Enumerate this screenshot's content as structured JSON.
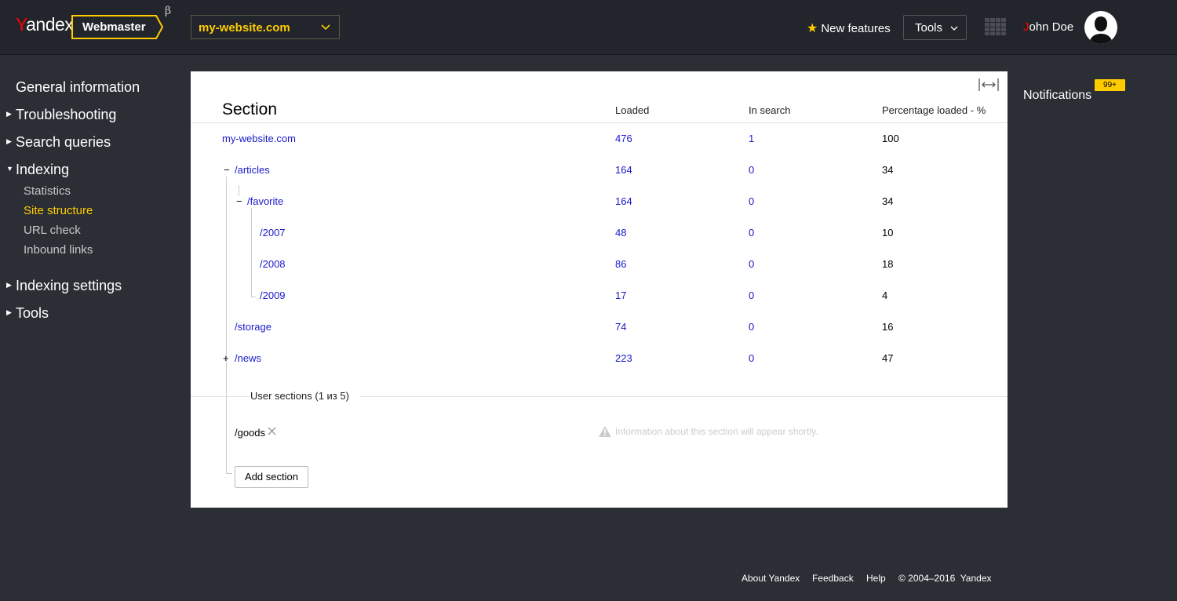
{
  "header": {
    "logo_y": "Y",
    "logo_rest": "andex",
    "product_label": "Webmaster",
    "beta_symbol": "β",
    "site_select_value": "my-website.com",
    "new_features_label": "New features",
    "tools_label": "Tools",
    "user_initial": "J",
    "user_rest": "ohn Doe",
    "accent_color": "#ffcc00"
  },
  "sidebar": {
    "general": "General information",
    "troubleshooting": "Troubleshooting",
    "search_queries": "Search queries",
    "indexing": "Indexing",
    "statistics": "Statistics",
    "site_structure": "Site structure",
    "url_check": "URL check",
    "inbound_links": "Inbound links",
    "indexing_settings": "Indexing settings",
    "tools": "Tools"
  },
  "table": {
    "headers": {
      "section": "Section",
      "loaded": "Loaded",
      "in_search": "In search",
      "percentage": "Percentage loaded - %"
    },
    "rows": [
      {
        "name": "my-website.com",
        "loaded": "476",
        "in_search": "1",
        "percent": "100"
      },
      {
        "name": "/articles",
        "loaded": "164",
        "in_search": "0",
        "percent": "34",
        "toggle": "−"
      },
      {
        "name": "/favorite",
        "loaded": "164",
        "in_search": "0",
        "percent": "34",
        "toggle": "−"
      },
      {
        "name": "/2007",
        "loaded": "48",
        "in_search": "0",
        "percent": "10"
      },
      {
        "name": "/2008",
        "loaded": "86",
        "in_search": "0",
        "percent": "18"
      },
      {
        "name": "/2009",
        "loaded": "17",
        "in_search": "0",
        "percent": "4"
      },
      {
        "name": "/storage",
        "loaded": "74",
        "in_search": "0",
        "percent": "16"
      },
      {
        "name": "/news",
        "loaded": "223",
        "in_search": "0",
        "percent": "47",
        "toggle": "+"
      }
    ]
  },
  "user_sections": {
    "label": "User sections (1 из 5)",
    "items": [
      {
        "name": "/goods"
      }
    ],
    "info_message": "Information about this section will appear shortly.",
    "add_button": "Add section"
  },
  "notifications": {
    "label": "Notifications",
    "count": "99+"
  },
  "footer": {
    "about": "About Yandex",
    "feedback": "Feedback",
    "help": "Help",
    "copyright": "© 2004–2016  Yandex"
  }
}
